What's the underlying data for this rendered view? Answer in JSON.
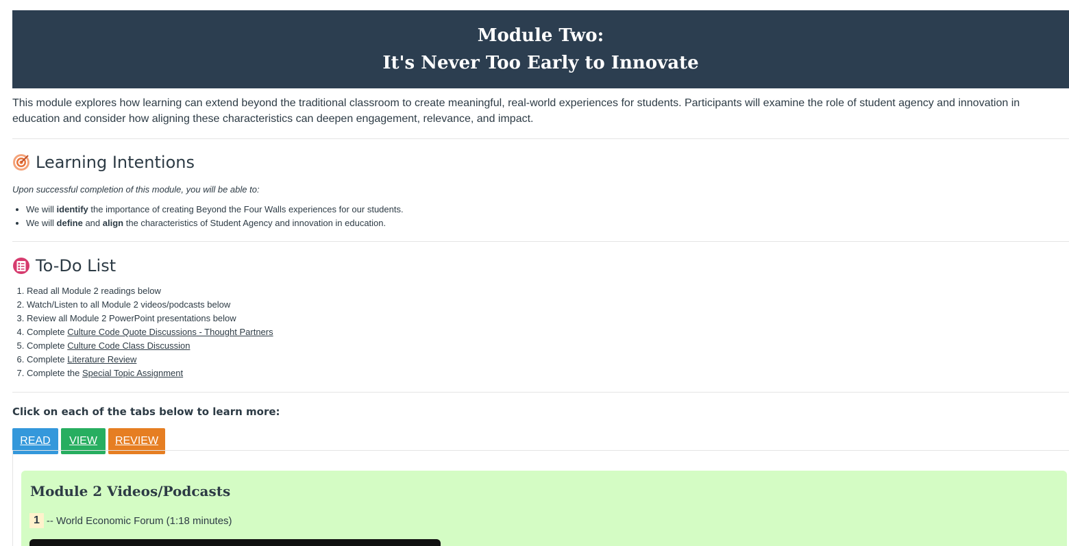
{
  "banner": {
    "line1": "Module Two:",
    "line2": "It's Never Too Early to Innovate",
    "bg_color": "#2c3e50"
  },
  "intro": "This module explores how learning can extend beyond the traditional classroom to create meaningful, real-world experiences for students. Participants will examine the role of student agency and innovation in education and consider how aligning these characteristics can deepen engagement, relevance, and impact.",
  "learning": {
    "icon": "target-icon",
    "heading": "Learning Intentions",
    "note": "Upon successful completion of this module, you will be able to:",
    "items": [
      {
        "pre": "We will ",
        "b1": "identify",
        "mid": " the importance of creating Beyond the Four Walls experiences for our students.",
        "b2": "",
        "post": ""
      },
      {
        "pre": "We will ",
        "b1": "define",
        "mid": " and ",
        "b2": "align",
        "post": " the characteristics of Student Agency and innovation in education."
      }
    ]
  },
  "todo": {
    "icon": "checklist-icon",
    "heading": "To-Do List",
    "items": [
      {
        "text": "Read all Module 2 readings below",
        "link": ""
      },
      {
        "text": "Watch/Listen to all Module 2 videos/podcasts below",
        "link": ""
      },
      {
        "text": "Review all Module 2 PowerPoint presentations below",
        "link": ""
      },
      {
        "text": "Complete ",
        "link": "Culture Code Quote Discussions - Thought Partners"
      },
      {
        "text": "Complete ",
        "link": "Culture Code Class Discussion"
      },
      {
        "text": "Complete ",
        "link": "Literature Review"
      },
      {
        "text": "Complete the ",
        "link": "Special Topic Assignment"
      }
    ]
  },
  "tabs": {
    "prompt": "Click on each of the tabs below to learn more:",
    "items": [
      {
        "label": "READ",
        "color": "#3498db"
      },
      {
        "label": "VIEW",
        "color": "#27ae60"
      },
      {
        "label": "REVIEW",
        "color": "#e67e22"
      }
    ]
  },
  "panel": {
    "title": "Module 2 Videos/Podcasts",
    "bg_color": "#d4fcc4",
    "video1": {
      "number": "1",
      "text": "-- World Economic Forum (1:18 minutes)"
    }
  }
}
